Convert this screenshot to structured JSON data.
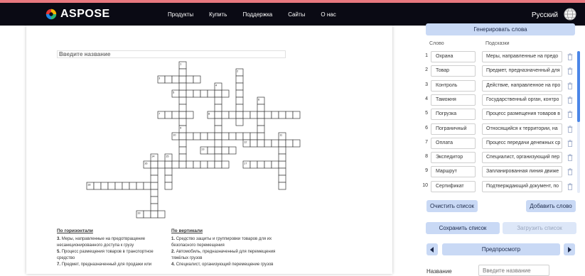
{
  "header": {
    "logo_text": "ASPOSE",
    "nav": [
      "Продукты",
      "Купить",
      "Поддержка",
      "Сайты",
      "О нас"
    ],
    "language": "Русский",
    "colors": {
      "background": "#0a0a14",
      "stripe": "#e8787f"
    }
  },
  "puzzle": {
    "title_placeholder": "Введите название"
  },
  "clues": {
    "across_heading": "По горизонтали",
    "down_heading": "По вертикали",
    "across": [
      {
        "num": "3.",
        "text": "Меры, направленные на предотвращение несанкционированного доступа к грузу"
      },
      {
        "num": "5.",
        "text": "Процесс размещения товаров в транспортное средство"
      },
      {
        "num": "7.",
        "text": "Предмет, предназначенный для продажи или"
      }
    ],
    "down": [
      {
        "num": "1.",
        "text": "Средство защиты и группировки товаров для их безопасного перемещения"
      },
      {
        "num": "2.",
        "text": "Автомобиль, предназначенный для перемещения тяжёлых грузов"
      },
      {
        "num": "4.",
        "text": "Специалист, организующий перемещение грузов"
      }
    ]
  },
  "sidebar": {
    "generate_label": "Генерировать слова",
    "col_word": "Слово",
    "col_hint": "Подсказки",
    "rows": [
      {
        "num": "1",
        "word": "Охрана",
        "hint": "Меры, направленные на предо"
      },
      {
        "num": "2",
        "word": "Товар",
        "hint": "Предмет, предназначенный для"
      },
      {
        "num": "3",
        "word": "Контроль",
        "hint": "Действие, направленное на про"
      },
      {
        "num": "4",
        "word": "Таможня",
        "hint": "Государственный орган, контро"
      },
      {
        "num": "5",
        "word": "Погрузка",
        "hint": "Процесс размещения товаров в"
      },
      {
        "num": "6",
        "word": "Пограничный",
        "hint": "Относящийся к территории, на"
      },
      {
        "num": "7",
        "word": "Оплата",
        "hint": "Процесс передачи денежных ср"
      },
      {
        "num": "8",
        "word": "Экспедитор",
        "hint": "Специалист, организующий пер"
      },
      {
        "num": "9",
        "word": "Маршрут",
        "hint": "Запланированная линия движе"
      },
      {
        "num": "10",
        "word": "Сертификат",
        "hint": "Подтверждающий документ, по"
      }
    ],
    "clear_label": "Очистить список",
    "add_label": "Добавить слово",
    "save_label": "Сохранить список",
    "load_label": "Загрузить список",
    "preview_label": "Предпросмотр",
    "name_label": "Название",
    "name_placeholder": "Введите название",
    "colors": {
      "button": "#c9d9f5",
      "accent": "#4a86e8"
    }
  }
}
